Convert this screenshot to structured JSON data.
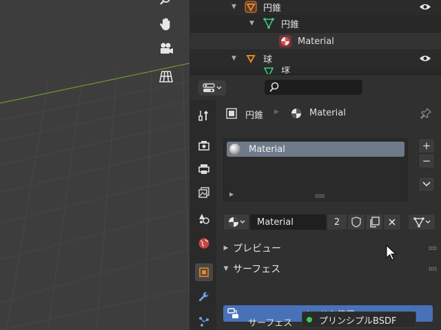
{
  "outliner": {
    "rows": [
      {
        "label": "円錐",
        "icon": "object-cone-icon"
      },
      {
        "label": "円錐",
        "icon": "mesh-data-icon"
      },
      {
        "label": "Material",
        "icon": "material-icon"
      },
      {
        "label": "球",
        "icon": "object-sphere-icon"
      },
      {
        "label": "球",
        "icon": "mesh-data-icon"
      }
    ]
  },
  "props": {
    "breadcrumb": {
      "object": "円錐",
      "material": "Material"
    },
    "slot": {
      "label": "Material"
    },
    "material_name": "Material",
    "users": "2",
    "panels": {
      "preview": "プレビュー",
      "surface": "サーフェス"
    },
    "use_nodes": "ノードを使用",
    "surface_label": "サーフェス",
    "surface_value": "プリンシプルBSDF"
  },
  "colors": {
    "accent": "#4872b8",
    "object_orange": "#e8862a",
    "mesh_green": "#3fd27f",
    "material_red": "#d84a4a"
  }
}
